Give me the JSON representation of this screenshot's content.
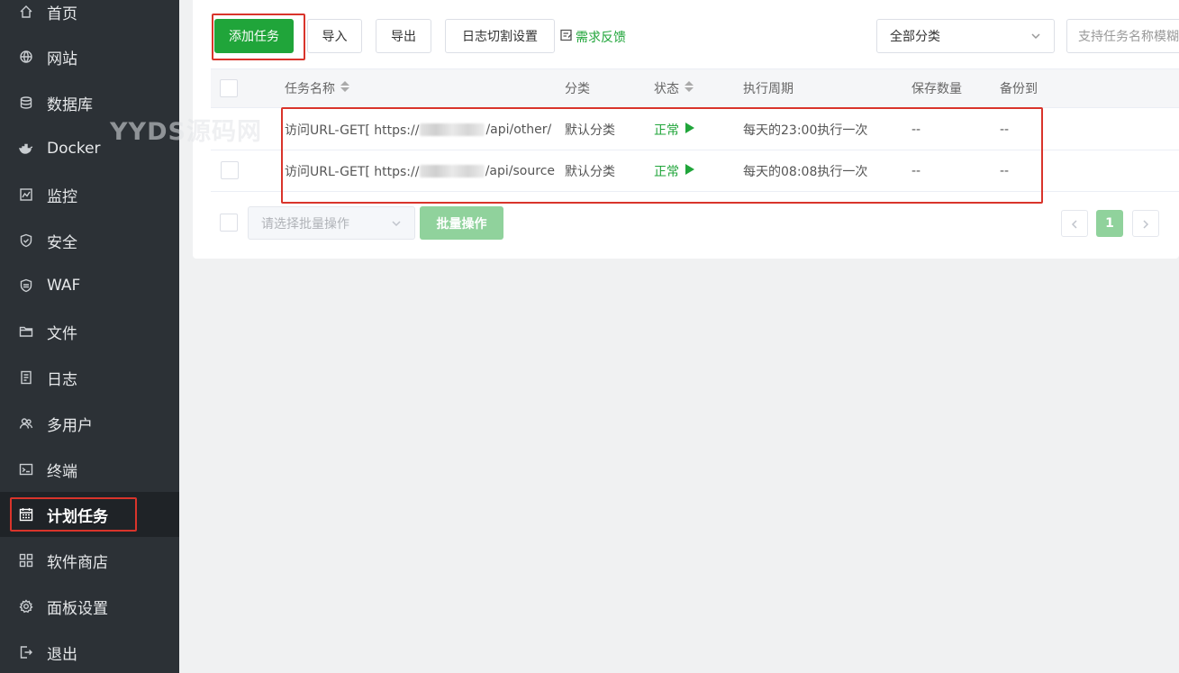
{
  "sidebar": {
    "items": [
      {
        "label": "首页",
        "icon": "home-icon"
      },
      {
        "label": "网站",
        "icon": "globe-icon"
      },
      {
        "label": "数据库",
        "icon": "database-icon"
      },
      {
        "label": "Docker",
        "icon": "docker-icon"
      },
      {
        "label": "监控",
        "icon": "monitor-icon"
      },
      {
        "label": "安全",
        "icon": "shield-icon"
      },
      {
        "label": "WAF",
        "icon": "waf-shield-icon"
      },
      {
        "label": "文件",
        "icon": "folder-icon"
      },
      {
        "label": "日志",
        "icon": "log-icon"
      },
      {
        "label": "多用户",
        "icon": "users-icon"
      },
      {
        "label": "终端",
        "icon": "terminal-icon"
      },
      {
        "label": "计划任务",
        "icon": "calendar-icon",
        "active": true
      },
      {
        "label": "软件商店",
        "icon": "grid-icon"
      },
      {
        "label": "面板设置",
        "icon": "settings-icon"
      },
      {
        "label": "退出",
        "icon": "logout-icon"
      }
    ]
  },
  "watermark": "YYDS源码网",
  "toolbar": {
    "add_task": "添加任务",
    "import": "导入",
    "export": "导出",
    "log_cut_settings": "日志切割设置",
    "feedback": "需求反馈",
    "category_select": "全部分类",
    "search_placeholder": "支持任务名称模糊"
  },
  "table": {
    "headers": {
      "name": "任务名称",
      "category": "分类",
      "status": "状态",
      "cycle": "执行周期",
      "save_count": "保存数量",
      "backup_to": "备份到"
    },
    "rows": [
      {
        "name_prefix": "访问URL-GET[ https://",
        "name_suffix": "/api/other/",
        "category": "默认分类",
        "status": "正常",
        "cycle": "每天的23:00执行一次",
        "save_count": "--",
        "backup_to": "--"
      },
      {
        "name_prefix": "访问URL-GET[ https://",
        "name_suffix": "/api/source",
        "category": "默认分类",
        "status": "正常",
        "cycle": "每天的08:08执行一次",
        "save_count": "--",
        "backup_to": "--"
      }
    ]
  },
  "batch": {
    "placeholder": "请选择批量操作",
    "button": "批量操作"
  },
  "pagination": {
    "current_page": "1"
  },
  "colors": {
    "primary": "#20a53a",
    "sidebar_bg": "#2c3136",
    "highlight": "#d9342b"
  }
}
